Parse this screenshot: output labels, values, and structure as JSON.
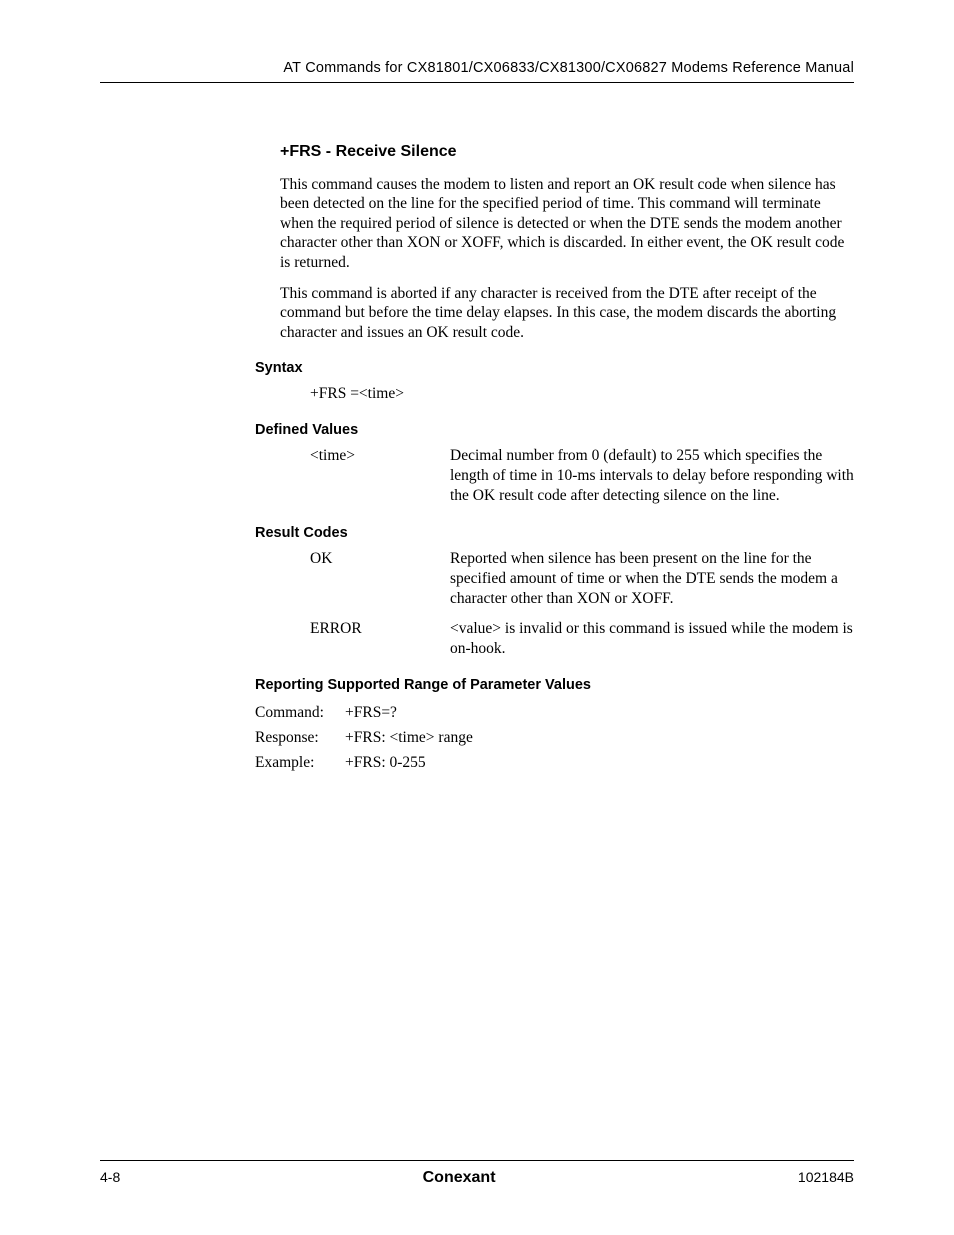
{
  "header": {
    "running_title": "AT Commands for CX81801/CX06833/CX81300/CX06827 Modems Reference Manual"
  },
  "section": {
    "title": "+FRS - Receive Silence",
    "para1": "This command causes the modem to listen and report an OK result code when silence has been detected on the line for the specified period of time. This command will terminate when the required period of silence is detected or when the DTE sends the modem another character other than XON or XOFF, which is discarded. In either event, the OK result code is returned.",
    "para2": "This command is aborted if any character is received from the DTE after receipt of the command but before the time delay elapses. In this case, the modem discards the aborting character and issues an OK result code."
  },
  "syntax": {
    "heading": "Syntax",
    "line": "+FRS =<time>"
  },
  "defined_values": {
    "heading": "Defined Values",
    "rows": [
      {
        "term": "<time>",
        "desc": "Decimal number from 0 (default) to 255 which specifies the length of time in 10-ms intervals to delay before responding with the OK result code after detecting silence on the line."
      }
    ]
  },
  "result_codes": {
    "heading": "Result Codes",
    "rows": [
      {
        "term": "OK",
        "desc": "Reported when silence has been present on the line for the specified amount of time or when the DTE sends the modem a character other than XON or XOFF."
      },
      {
        "term": "ERROR",
        "desc": "<value> is invalid or this command is issued while the modem is on-hook."
      }
    ]
  },
  "reporting": {
    "heading": "Reporting Supported Range of Parameter Values",
    "rows": [
      {
        "label": "Command:",
        "value": "+FRS=?"
      },
      {
        "label": "Response:",
        "value": "+FRS: <time> range"
      },
      {
        "label": "Example:",
        "value": "+FRS: 0-255"
      }
    ]
  },
  "footer": {
    "page_num": "4-8",
    "brand": "Conexant",
    "doc_id": "102184B"
  }
}
